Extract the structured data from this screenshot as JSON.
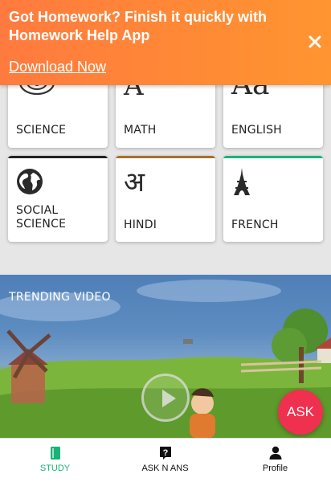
{
  "banner": {
    "headline": "Got Homework? Finish it quickly with Homework Help App",
    "link_label": "Download Now",
    "background": "#ff8a35"
  },
  "subjects": [
    {
      "label": "SCIENCE",
      "icon": "atom-icon"
    },
    {
      "label": "MATH",
      "icon": "math-a-icon"
    },
    {
      "label": "ENGLISH",
      "icon": "aa-letters-icon"
    },
    {
      "label": "SOCIAL\nSCIENCE",
      "icon": "globe-icon",
      "accent": "#222222"
    },
    {
      "label": "HINDI",
      "icon": "devanagari-a-icon",
      "accent": "#a7702b"
    },
    {
      "label": "FRENCH",
      "icon": "eiffel-tower-icon",
      "accent": "#19b37a"
    }
  ],
  "trending": {
    "title": "TRENDING VIDEO"
  },
  "ask_button": {
    "label": "ASK",
    "color": "#f0304f"
  },
  "nav": {
    "study": {
      "label": "STUDY",
      "icon": "book-icon",
      "active_color": "#19b37a"
    },
    "ask": {
      "label": "ASK N ANS",
      "icon": "question-icon"
    },
    "profile": {
      "label": "Profile",
      "icon": "person-icon"
    }
  },
  "glyphs": {
    "math": "A",
    "english": "Aa",
    "hindi": "अ"
  }
}
